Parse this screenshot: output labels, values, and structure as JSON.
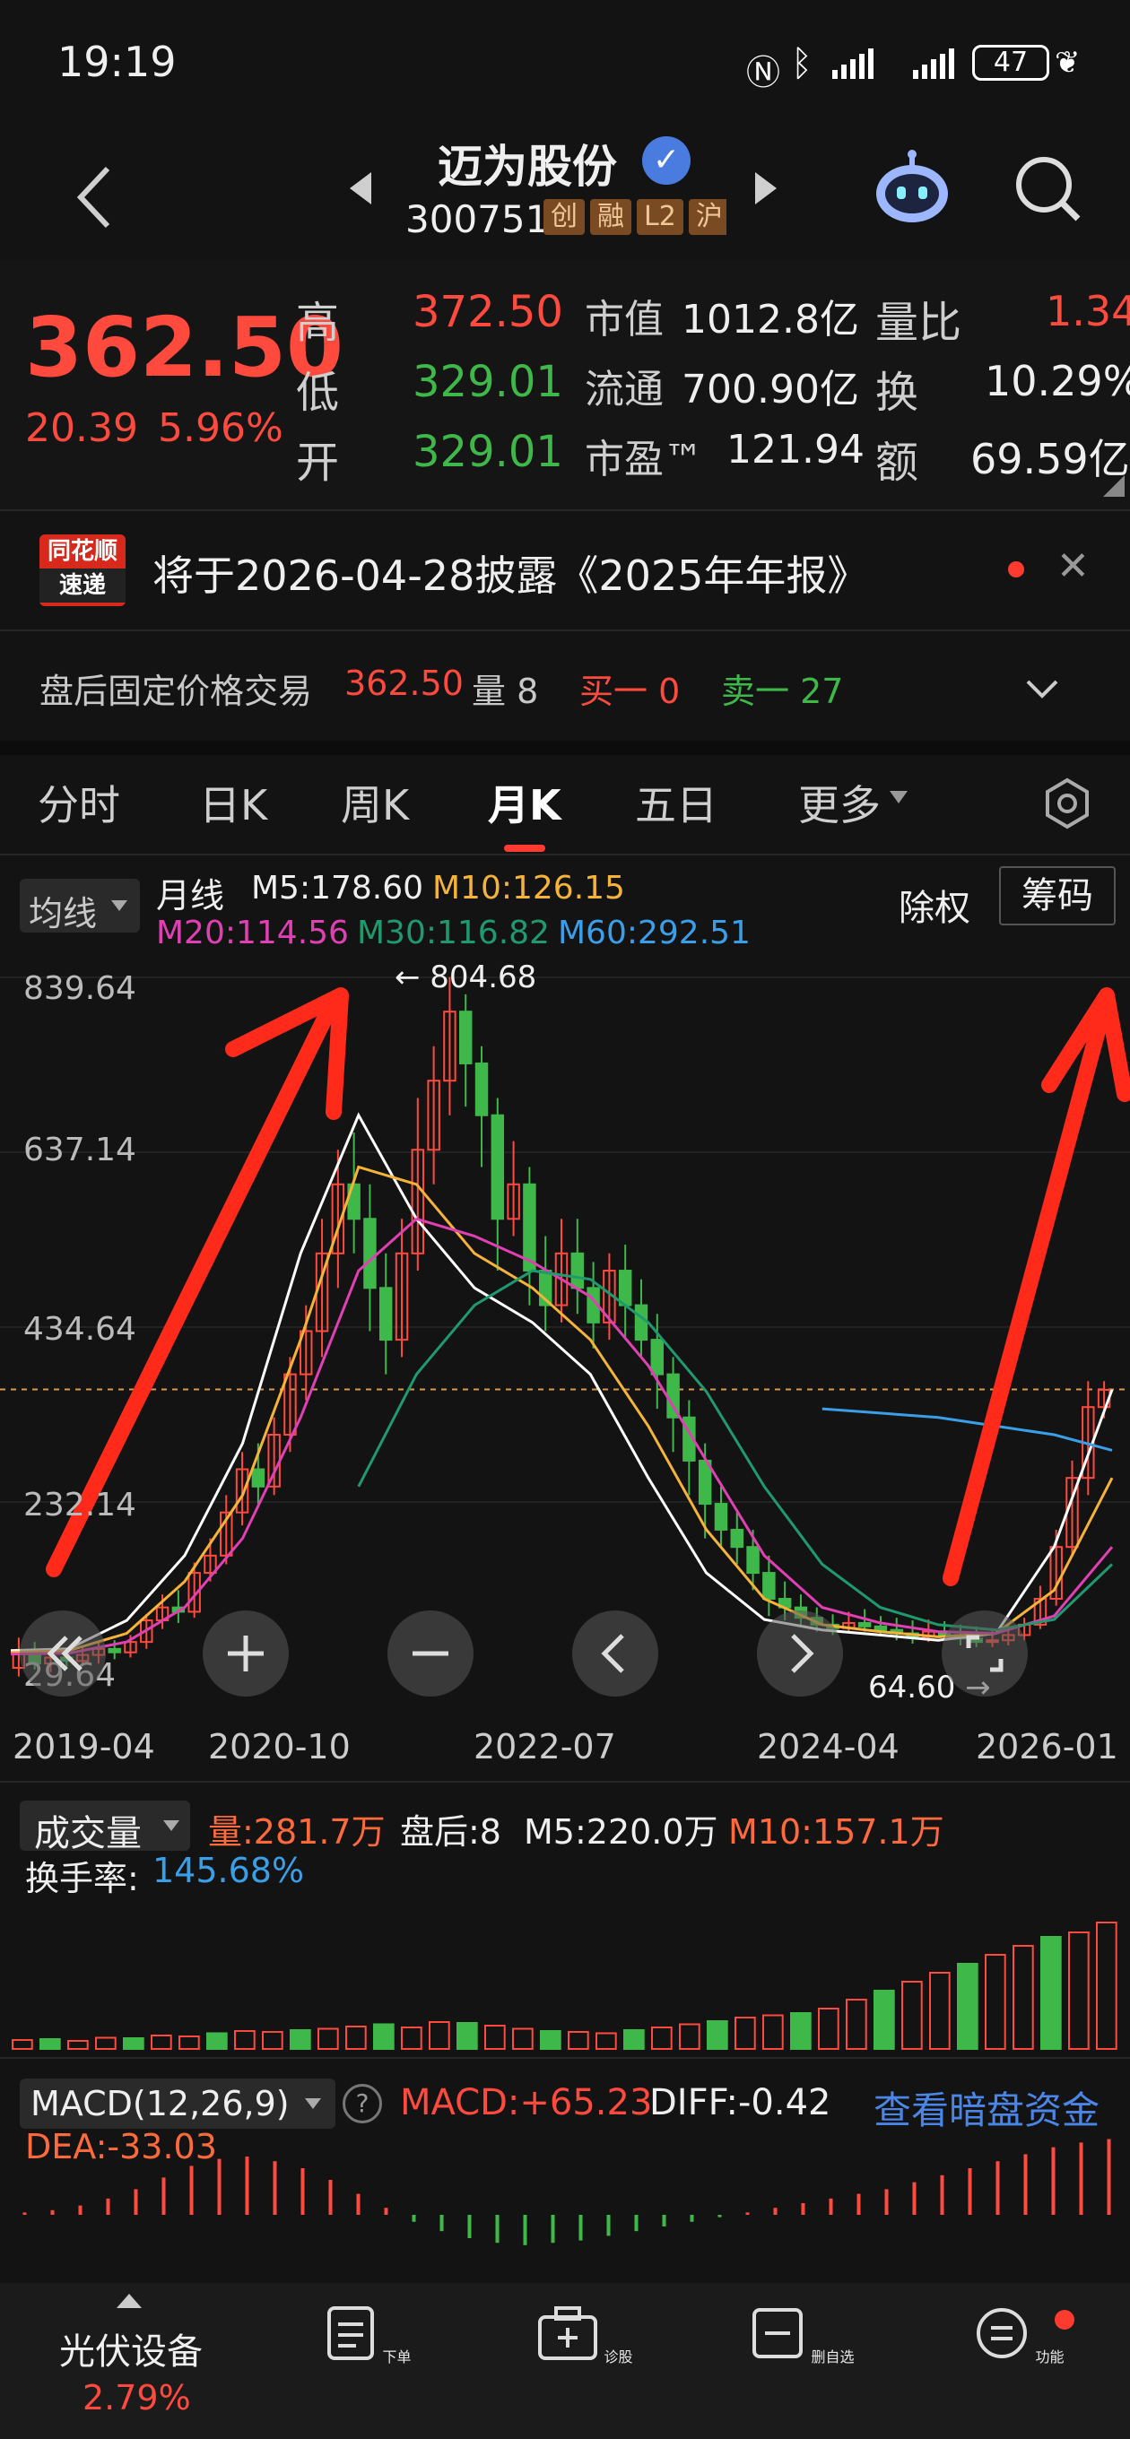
{
  "status_bar": {
    "time": "19:19",
    "battery": "47"
  },
  "header": {
    "title": "迈为股份",
    "code": "300751",
    "tags": [
      "创",
      "融",
      "L2",
      "沪"
    ]
  },
  "quote": {
    "price": "362.50",
    "change": "20.39",
    "change_pct": "5.96%",
    "high_label": "高",
    "high": "372.50",
    "low_label": "低",
    "low": "329.01",
    "open_label": "开",
    "open": "329.01",
    "mktcap_label": "市值",
    "mktcap": "1012.8亿",
    "float_label": "流通",
    "float": "700.90亿",
    "pe_label": "市盈™",
    "pe": "121.94",
    "vr_label": "量比",
    "vr": "1.34",
    "turnover_label": "换",
    "turnover": "10.29%",
    "amount_label": "额",
    "amount": "69.59亿"
  },
  "news": {
    "badge_top": "同花顺",
    "badge_bottom": "速递",
    "text": "将于2026-04-28披露《2025年年报》"
  },
  "after_hours": {
    "label": "盘后固定价格交易",
    "price": "362.50",
    "vol_label": "量 8",
    "buy": "买一 0",
    "sell": "卖一 27"
  },
  "tabs": [
    "分时",
    "日K",
    "周K",
    "月K",
    "五日",
    "更多"
  ],
  "active_tab": "月K",
  "ma": {
    "selector": "均线",
    "period": "月线",
    "m5": "M5:178.60",
    "m10": "M10:126.15",
    "m20": "M20:114.56",
    "m30": "M30:116.82",
    "m60": "M60:292.51",
    "adjust": "除权",
    "chips": "筹码"
  },
  "price_axis": [
    "839.64",
    "637.14",
    "434.64",
    "232.14",
    "29.64"
  ],
  "annotations": {
    "high_marker": "804.68",
    "low_marker": "64.60"
  },
  "date_axis": [
    "2019-04",
    "2020-10",
    "2022-07",
    "2024-04",
    "2026-01"
  ],
  "volume": {
    "selector": "成交量",
    "vol": "量:281.7万",
    "after": "盘后:8",
    "m5": "M5:220.0万",
    "m10": "M10:157.1万",
    "turnover_label": "换手率:",
    "turnover": "145.68%"
  },
  "macd": {
    "selector": "MACD(12,26,9)",
    "macd": "MACD:+65.23",
    "diff": "DIFF:-0.42",
    "dea": "DEA:-33.03",
    "link": "查看暗盘资金"
  },
  "bottom_nav": {
    "sector": "光伏设备",
    "sector_change": "2.79%",
    "items": [
      "下单",
      "诊股",
      "删自选",
      "功能"
    ]
  },
  "colors": {
    "up": "#ff4a3d",
    "down": "#3fb84a",
    "m5": "#ffffff",
    "m10": "#f5b338",
    "m20": "#e040b4",
    "m30": "#1f9a6e",
    "m60": "#3a9fe8"
  },
  "chart_data": {
    "type": "candlestick",
    "price_ylim": [
      29.64,
      839.64
    ],
    "candles": [
      [
        40,
        60,
        30,
        75
      ],
      [
        55,
        45,
        38,
        70
      ],
      [
        45,
        52,
        35,
        62
      ],
      [
        52,
        48,
        40,
        60
      ],
      [
        48,
        55,
        42,
        66
      ],
      [
        55,
        62,
        45,
        70
      ],
      [
        62,
        58,
        50,
        72
      ],
      [
        58,
        70,
        52,
        78
      ],
      [
        70,
        95,
        62,
        102
      ],
      [
        95,
        110,
        85,
        125
      ],
      [
        110,
        105,
        92,
        130
      ],
      [
        105,
        150,
        98,
        162
      ],
      [
        150,
        170,
        140,
        190
      ],
      [
        170,
        220,
        160,
        240
      ],
      [
        220,
        270,
        205,
        290
      ],
      [
        270,
        250,
        230,
        300
      ],
      [
        250,
        310,
        240,
        330
      ],
      [
        310,
        380,
        290,
        400
      ],
      [
        380,
        430,
        350,
        460
      ],
      [
        430,
        520,
        400,
        560
      ],
      [
        520,
        600,
        480,
        640
      ],
      [
        600,
        560,
        520,
        660
      ],
      [
        560,
        480,
        430,
        600
      ],
      [
        480,
        420,
        380,
        520
      ],
      [
        420,
        520,
        400,
        560
      ],
      [
        520,
        640,
        500,
        700
      ],
      [
        640,
        720,
        600,
        760
      ],
      [
        720,
        800,
        680,
        840
      ],
      [
        800,
        740,
        690,
        820
      ],
      [
        740,
        680,
        620,
        760
      ],
      [
        680,
        560,
        500,
        700
      ],
      [
        560,
        600,
        540,
        650
      ],
      [
        600,
        500,
        460,
        620
      ],
      [
        500,
        460,
        430,
        540
      ],
      [
        460,
        520,
        440,
        560
      ],
      [
        520,
        480,
        450,
        560
      ],
      [
        480,
        440,
        410,
        510
      ],
      [
        440,
        500,
        420,
        520
      ],
      [
        500,
        460,
        420,
        530
      ],
      [
        460,
        420,
        400,
        490
      ],
      [
        420,
        380,
        340,
        450
      ],
      [
        380,
        330,
        290,
        400
      ],
      [
        330,
        280,
        240,
        350
      ],
      [
        280,
        230,
        190,
        300
      ],
      [
        230,
        200,
        180,
        250
      ],
      [
        200,
        180,
        160,
        220
      ],
      [
        180,
        150,
        130,
        200
      ],
      [
        150,
        120,
        100,
        170
      ],
      [
        120,
        110,
        95,
        140
      ],
      [
        110,
        98,
        90,
        125
      ],
      [
        98,
        90,
        82,
        110
      ],
      [
        90,
        86,
        78,
        102
      ],
      [
        86,
        92,
        80,
        105
      ],
      [
        92,
        88,
        82,
        108
      ],
      [
        88,
        84,
        78,
        100
      ],
      [
        84,
        80,
        72,
        98
      ],
      [
        80,
        76,
        68,
        95
      ],
      [
        76,
        82,
        70,
        96
      ],
      [
        82,
        78,
        72,
        94
      ],
      [
        78,
        74,
        66,
        90
      ],
      [
        74,
        70,
        64,
        88
      ],
      [
        70,
        72,
        64,
        86
      ],
      [
        72,
        78,
        66,
        90
      ],
      [
        78,
        90,
        72,
        98
      ],
      [
        90,
        120,
        85,
        135
      ],
      [
        120,
        180,
        112,
        200
      ],
      [
        180,
        260,
        170,
        280
      ],
      [
        260,
        342,
        240,
        372
      ],
      [
        342,
        362,
        329,
        372
      ]
    ],
    "lines": {
      "M5": [
        60,
        62,
        95,
        170,
        300,
        520,
        680,
        560,
        480,
        440,
        380,
        260,
        150,
        96,
        84,
        78,
        72,
        80,
        180,
        362
      ],
      "M10": [
        58,
        60,
        80,
        140,
        240,
        420,
        620,
        600,
        520,
        480,
        420,
        320,
        200,
        120,
        90,
        82,
        76,
        80,
        130,
        260
      ],
      "M20": [
        56,
        57,
        70,
        110,
        190,
        330,
        500,
        560,
        540,
        510,
        470,
        390,
        280,
        170,
        110,
        92,
        82,
        80,
        100,
        180
      ],
      "M30": [
        null,
        null,
        null,
        null,
        null,
        null,
        250,
        380,
        460,
        500,
        490,
        440,
        360,
        250,
        160,
        110,
        90,
        84,
        96,
        160
      ],
      "M60": [
        null,
        null,
        null,
        null,
        null,
        null,
        null,
        null,
        null,
        null,
        null,
        null,
        null,
        null,
        340,
        335,
        330,
        320,
        310,
        292
      ]
    },
    "volume": [
      20,
      22,
      18,
      25,
      24,
      30,
      28,
      35,
      40,
      38,
      42,
      45,
      50,
      55,
      48,
      60,
      58,
      52,
      45,
      40,
      38,
      35,
      42,
      48,
      55,
      62,
      70,
      75,
      80,
      90,
      110,
      130,
      150,
      170,
      190,
      210,
      230,
      250,
      260,
      282
    ],
    "macd": [
      2,
      4,
      8,
      14,
      22,
      32,
      42,
      48,
      50,
      46,
      40,
      30,
      18,
      6,
      -6,
      -14,
      -20,
      -24,
      -26,
      -24,
      -22,
      -18,
      -14,
      -10,
      -6,
      -2,
      2,
      6,
      10,
      14,
      18,
      22,
      28,
      34,
      40,
      46,
      52,
      58,
      62,
      65
    ]
  }
}
